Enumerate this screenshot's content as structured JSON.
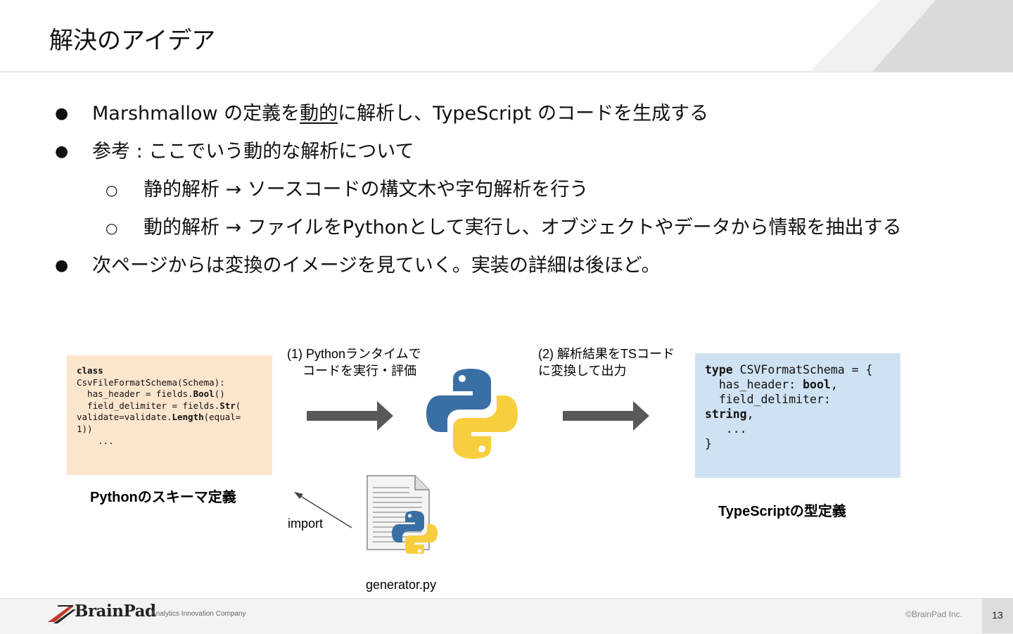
{
  "slide": {
    "title": "解決のアイデア",
    "page_number": "13",
    "copyright": "©BrainPad Inc.",
    "logo_text": "BrainPad",
    "tagline": "Analytics Innovation Company"
  },
  "bullets": [
    {
      "level": 1,
      "parts": [
        "Marshmallow の定義を",
        "動的",
        "に解析し、TypeScript のコードを生成する"
      ]
    },
    {
      "level": 1,
      "text": "参考 : ここでいう動的な解析について"
    },
    {
      "level": 2,
      "text": "静的解析 → ソースコードの構文木や字句解析を行う"
    },
    {
      "level": 2,
      "text": "動的解析 → ファイルをPythonとして実行し、オブジェクトやデータから情報を抽出する"
    },
    {
      "level": 1,
      "text": "次ページからは変換のイメージを見ていく。実装の詳細は後ほど。"
    }
  ],
  "diagram": {
    "python_code": "class\nCsvFileFormatSchema(Schema):\n  has_header = fields.Bool()\n  field_delimiter = fields.Str(\nvalidate=validate.Length(equal=\n1))\n    ...",
    "python_caption": "Pythonのスキーマ定義",
    "step1": [
      "(1) Pythonランタイムで",
      "コードを実行・評価"
    ],
    "step2": [
      "(2) 解析結果をTSコード",
      "に変換して出力"
    ],
    "ts_code": "type CSVFormatSchema = {\n  has_header: bool,\n  field_delimiter:\nstring,\n   ...\n}",
    "ts_caption": "TypeScriptの型定義",
    "import_label": "import",
    "file_label": "generator.py"
  },
  "colors": {
    "python_box": "#fce5cd",
    "ts_box": "#cfe2f3",
    "arrow": "#595959",
    "python_blue": "#3a6fa5",
    "python_yellow": "#f7cf3e"
  }
}
